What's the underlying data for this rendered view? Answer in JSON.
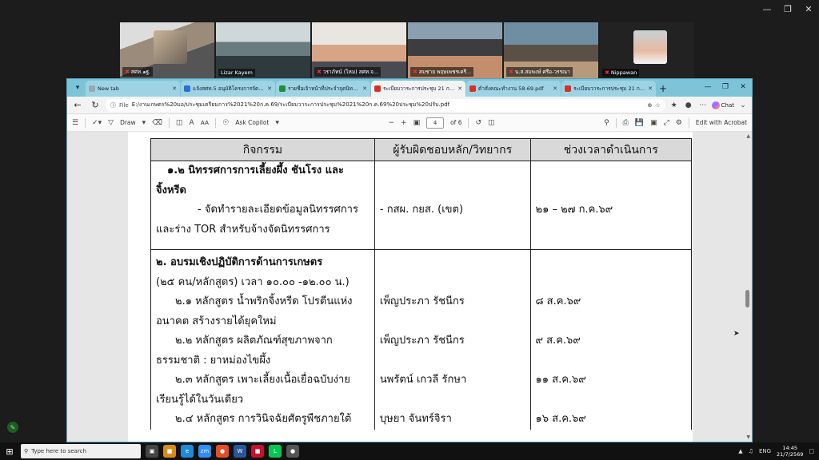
{
  "meeting": {
    "participants": [
      {
        "name": "สศท.๑ฐ.",
        "active": false,
        "scene": "cat"
      },
      {
        "name": "Lizar Kayem",
        "active": true,
        "scene": "office"
      },
      {
        "name": "วราภัทน์ (ไหม) สศท.จ...",
        "active": false,
        "scene": "woman"
      },
      {
        "name": "สมชาย พฤษเพชรเครี...",
        "active": false,
        "scene": "man"
      },
      {
        "name": "น.ส.สมพงษ์ ศรีอ-วรรณา",
        "active": false,
        "scene": "room"
      },
      {
        "name": "Nippawan",
        "active": false,
        "scene": "avatar"
      }
    ]
  },
  "browser": {
    "tabs": [
      {
        "label": "New tab",
        "active": false,
        "color": "#9aa9b0"
      },
      {
        "label": "แจ้งสศท.5 อนุมัติโครงการจัดนิทรรศ...",
        "active": false,
        "color": "#2b6fd6"
      },
      {
        "label": "รายชื่อเจ้าหน้าที่ประจำจุดนิทรรศการ...",
        "active": false,
        "color": "#1e8e3e"
      },
      {
        "label": "ระเบียบวาระการประชุม 21 ก.ค.69...",
        "active": true,
        "color": "#d93025"
      },
      {
        "label": "ตำสั่งคณะทำงาน 58-69.pdf",
        "active": false,
        "color": "#d93025"
      },
      {
        "label": "ระเบียบวาระการประชุม 21 ก.ค.69...",
        "active": false,
        "color": "#d93025"
      }
    ],
    "address": {
      "prefix": "File",
      "url": "E:/งานเกษตร%20มอ/ประชุมเตรียมการ%2021%20ก.ค.69/ระเบียบวาระการประชุม%2021%20ก.ค.69%20ประชุม%20ปรับ.pdf"
    },
    "chat_label": "Chat"
  },
  "pdf_toolbar": {
    "draw_label": "Draw",
    "ask_label": "Ask Copilot",
    "page_current": "4",
    "page_total": "of 6",
    "edit_label": "Edit with Acrobat"
  },
  "document": {
    "headers": [
      "กิจกรรม",
      "ผู้รับผิดชอบหลัก/วิทยากร",
      "ช่วงเวลาดำเนินการ"
    ],
    "section1": {
      "title_line1": "๑.๒ นิทรรศการการเลี้ยงผึ้ง ชันโรง และ",
      "title_line2": "จิ้งหรีด",
      "desc_line1": "- จัดทำรายละเอียดข้อมูลนิทรรศการ",
      "desc_line2": "และร่าง TOR สำหรับจ้างจัดนิทรรศการ",
      "responsible": "- กสผ. กยส.  (เขต)",
      "period": "๒๑ – ๒๗ ก.ค.๖๙"
    },
    "section2": {
      "title": "๒. อบรมเชิงปฏิบัติการด้านการเกษตร",
      "subtitle": "(๒๕ คน/หลักสูตร) เวลา ๑๐.๐๐ -๑๒.๐๐ น.)",
      "courses": [
        {
          "line1": "๒.๑ หลักสูตร น้ำพริกจิ้งหรีด โปรตีนแห่ง",
          "line2": "อนาคต สร้างรายได้ยุคใหม่",
          "responsible": "เพ็ญประภา รัชนีกร",
          "period": "๘ ส.ค.๖๙"
        },
        {
          "line1": "๒.๒ หลักสูตร ผลิตภัณฑ์สุขภาพจาก",
          "line2": "ธรรมชาติ : ยาหม่องไขผึ้ง",
          "responsible": "เพ็ญประภา รัชนีกร",
          "period": "๙ ส.ค.๖๙"
        },
        {
          "line1": "๒.๓ หลักสูตร เพาะเลี้ยงเนื้อเยื่อฉบับง่าย",
          "line2": "เรียนรู้ได้ในวันเดียว",
          "responsible": "นพรัตน์ เกวลี รักษา",
          "period": "๑๑ ส.ค.๖๙"
        },
        {
          "line1": "๒.๔ หลักสูตร การวินิจฉัยศัตรูพืชภายใต้",
          "line2": "",
          "responsible": "บุษยา จันทร์จิรา",
          "period": "๑๖ ส.ค.๖๙"
        }
      ]
    }
  },
  "taskbar": {
    "search_placeholder": "Type here to search",
    "lang": "ENG",
    "time": "14:45",
    "date": "21/7/2569"
  }
}
